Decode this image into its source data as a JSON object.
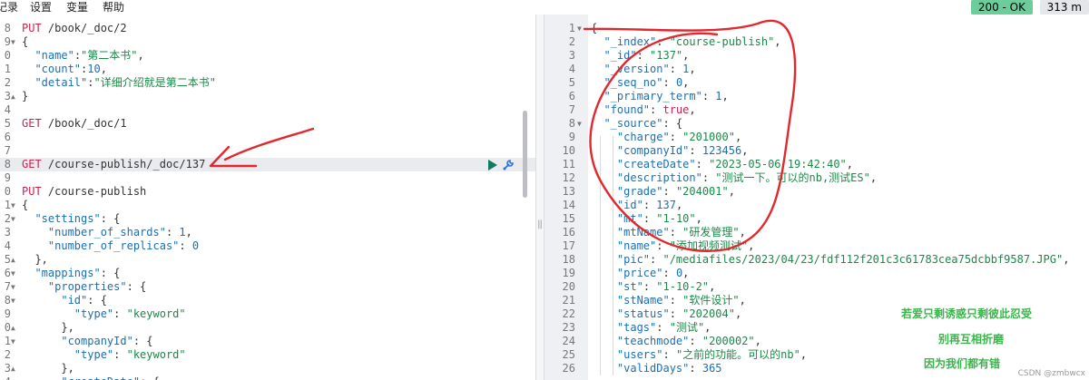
{
  "menu": [
    "记录",
    "设置",
    "变量",
    "帮助"
  ],
  "status": {
    "code": "200 - OK",
    "time": "313 m"
  },
  "left_editor": {
    "lines": [
      {
        "n": "8",
        "fold": "",
        "parts": [
          [
            "m",
            "PUT"
          ],
          [
            "p",
            " /book/_doc/2"
          ]
        ]
      },
      {
        "n": "9",
        "fold": "▼",
        "parts": [
          [
            "p",
            "{"
          ]
        ]
      },
      {
        "n": "0",
        "fold": "",
        "parts": [
          [
            "p",
            "  "
          ],
          [
            "k",
            "\"name\""
          ],
          [
            "p",
            ":"
          ],
          [
            "s",
            "\"第二本书\""
          ],
          [
            "p",
            ","
          ]
        ]
      },
      {
        "n": "1",
        "fold": "",
        "parts": [
          [
            "p",
            "  "
          ],
          [
            "k",
            "\"count\""
          ],
          [
            "p",
            ":"
          ],
          [
            "n",
            "10"
          ],
          [
            "p",
            ","
          ]
        ]
      },
      {
        "n": "2",
        "fold": "",
        "parts": [
          [
            "p",
            "  "
          ],
          [
            "k",
            "\"detail\""
          ],
          [
            "p",
            ":"
          ],
          [
            "s",
            "\"详细介绍就是第二本书\""
          ]
        ]
      },
      {
        "n": "3",
        "fold": "▲",
        "parts": [
          [
            "p",
            "}"
          ]
        ]
      },
      {
        "n": "4",
        "fold": "",
        "parts": []
      },
      {
        "n": "5",
        "fold": "",
        "parts": [
          [
            "m",
            "GET"
          ],
          [
            "p",
            " /book/_doc/1"
          ]
        ]
      },
      {
        "n": "6",
        "fold": "",
        "parts": []
      },
      {
        "n": "7",
        "fold": "",
        "parts": []
      },
      {
        "n": "8",
        "fold": "",
        "parts": [
          [
            "m",
            "GET"
          ],
          [
            "p",
            " /course-publish/_doc/137"
          ]
        ],
        "hl": true
      },
      {
        "n": "9",
        "fold": "",
        "parts": []
      },
      {
        "n": "0",
        "fold": "",
        "parts": [
          [
            "m",
            "PUT"
          ],
          [
            "p",
            " /course-publish"
          ]
        ]
      },
      {
        "n": "1",
        "fold": "▼",
        "parts": [
          [
            "p",
            "{"
          ]
        ]
      },
      {
        "n": "2",
        "fold": "▼",
        "parts": [
          [
            "p",
            "  "
          ],
          [
            "k",
            "\"settings\""
          ],
          [
            "p",
            ": {"
          ]
        ]
      },
      {
        "n": "3",
        "fold": "",
        "parts": [
          [
            "p",
            "    "
          ],
          [
            "k",
            "\"number_of_shards\""
          ],
          [
            "p",
            ": "
          ],
          [
            "n",
            "1"
          ],
          [
            "p",
            ","
          ]
        ]
      },
      {
        "n": "4",
        "fold": "",
        "parts": [
          [
            "p",
            "    "
          ],
          [
            "k",
            "\"number_of_replicas\""
          ],
          [
            "p",
            ": "
          ],
          [
            "n",
            "0"
          ]
        ]
      },
      {
        "n": "5",
        "fold": "▲",
        "parts": [
          [
            "p",
            "  },"
          ]
        ]
      },
      {
        "n": "6",
        "fold": "▼",
        "parts": [
          [
            "p",
            "  "
          ],
          [
            "k",
            "\"mappings\""
          ],
          [
            "p",
            ": {"
          ]
        ]
      },
      {
        "n": "7",
        "fold": "▼",
        "parts": [
          [
            "p",
            "    "
          ],
          [
            "k",
            "\"properties\""
          ],
          [
            "p",
            ": {"
          ]
        ]
      },
      {
        "n": "8",
        "fold": "▼",
        "parts": [
          [
            "p",
            "      "
          ],
          [
            "k",
            "\"id\""
          ],
          [
            "p",
            ": {"
          ]
        ]
      },
      {
        "n": "9",
        "fold": "",
        "parts": [
          [
            "p",
            "        "
          ],
          [
            "k",
            "\"type\""
          ],
          [
            "p",
            ": "
          ],
          [
            "s",
            "\"keyword\""
          ]
        ]
      },
      {
        "n": "0",
        "fold": "▲",
        "parts": [
          [
            "p",
            "      },"
          ]
        ]
      },
      {
        "n": "1",
        "fold": "▼",
        "parts": [
          [
            "p",
            "      "
          ],
          [
            "k",
            "\"companyId\""
          ],
          [
            "p",
            ": {"
          ]
        ]
      },
      {
        "n": "2",
        "fold": "",
        "parts": [
          [
            "p",
            "        "
          ],
          [
            "k",
            "\"type\""
          ],
          [
            "p",
            ": "
          ],
          [
            "s",
            "\"keyword\""
          ]
        ]
      },
      {
        "n": "3",
        "fold": "▲",
        "parts": [
          [
            "p",
            "      },"
          ]
        ]
      },
      {
        "n": "4",
        "fold": "",
        "parts": [
          [
            "p",
            "      "
          ],
          [
            "k",
            "\"createDate\""
          ],
          [
            "p",
            ": {"
          ]
        ]
      }
    ]
  },
  "right_editor": {
    "lines": [
      {
        "n": "1",
        "fold": "▼",
        "parts": [
          [
            "p",
            "{"
          ]
        ]
      },
      {
        "n": "2",
        "fold": "",
        "parts": [
          [
            "p",
            "  "
          ],
          [
            "k",
            "\"_index\""
          ],
          [
            "p",
            ": "
          ],
          [
            "s",
            "\"course-publish\""
          ],
          [
            "p",
            ","
          ]
        ]
      },
      {
        "n": "3",
        "fold": "",
        "parts": [
          [
            "p",
            "  "
          ],
          [
            "k",
            "\"_id\""
          ],
          [
            "p",
            ": "
          ],
          [
            "s",
            "\"137\""
          ],
          [
            "p",
            ","
          ]
        ]
      },
      {
        "n": "4",
        "fold": "",
        "parts": [
          [
            "p",
            "  "
          ],
          [
            "k",
            "\"_version\""
          ],
          [
            "p",
            ": "
          ],
          [
            "n",
            "1"
          ],
          [
            "p",
            ","
          ]
        ]
      },
      {
        "n": "5",
        "fold": "",
        "parts": [
          [
            "p",
            "  "
          ],
          [
            "k",
            "\"_seq_no\""
          ],
          [
            "p",
            ": "
          ],
          [
            "n",
            "0"
          ],
          [
            "p",
            ","
          ]
        ]
      },
      {
        "n": "6",
        "fold": "",
        "parts": [
          [
            "p",
            "  "
          ],
          [
            "k",
            "\"_primary_term\""
          ],
          [
            "p",
            ": "
          ],
          [
            "n",
            "1"
          ],
          [
            "p",
            ","
          ]
        ]
      },
      {
        "n": "7",
        "fold": "",
        "parts": [
          [
            "p",
            "  "
          ],
          [
            "k",
            "\"found\""
          ],
          [
            "p",
            ": "
          ],
          [
            "b",
            "true"
          ],
          [
            "p",
            ","
          ]
        ]
      },
      {
        "n": "8",
        "fold": "▼",
        "parts": [
          [
            "p",
            "  "
          ],
          [
            "k",
            "\"_source\""
          ],
          [
            "p",
            ": {"
          ]
        ]
      },
      {
        "n": "9",
        "fold": "",
        "parts": [
          [
            "p",
            "    "
          ],
          [
            "k",
            "\"charge\""
          ],
          [
            "p",
            ": "
          ],
          [
            "s",
            "\"201000\""
          ],
          [
            "p",
            ","
          ]
        ]
      },
      {
        "n": "10",
        "fold": "",
        "parts": [
          [
            "p",
            "    "
          ],
          [
            "k",
            "\"companyId\""
          ],
          [
            "p",
            ": "
          ],
          [
            "n",
            "123456"
          ],
          [
            "p",
            ","
          ]
        ]
      },
      {
        "n": "11",
        "fold": "",
        "parts": [
          [
            "p",
            "    "
          ],
          [
            "k",
            "\"createDate\""
          ],
          [
            "p",
            ": "
          ],
          [
            "s",
            "\"2023-05-06 19:42:40\""
          ],
          [
            "p",
            ","
          ]
        ]
      },
      {
        "n": "12",
        "fold": "",
        "parts": [
          [
            "p",
            "    "
          ],
          [
            "k",
            "\"description\""
          ],
          [
            "p",
            ": "
          ],
          [
            "s",
            "\"测试一下。可以的nb,测试ES\""
          ],
          [
            "p",
            ","
          ]
        ]
      },
      {
        "n": "13",
        "fold": "",
        "parts": [
          [
            "p",
            "    "
          ],
          [
            "k",
            "\"grade\""
          ],
          [
            "p",
            ": "
          ],
          [
            "s",
            "\"204001\""
          ],
          [
            "p",
            ","
          ]
        ]
      },
      {
        "n": "14",
        "fold": "",
        "parts": [
          [
            "p",
            "    "
          ],
          [
            "k",
            "\"id\""
          ],
          [
            "p",
            ": "
          ],
          [
            "n",
            "137"
          ],
          [
            "p",
            ","
          ]
        ]
      },
      {
        "n": "15",
        "fold": "",
        "parts": [
          [
            "p",
            "    "
          ],
          [
            "k",
            "\"mt\""
          ],
          [
            "p",
            ": "
          ],
          [
            "s",
            "\"1-10\""
          ],
          [
            "p",
            ","
          ]
        ]
      },
      {
        "n": "16",
        "fold": "",
        "parts": [
          [
            "p",
            "    "
          ],
          [
            "k",
            "\"mtName\""
          ],
          [
            "p",
            ": "
          ],
          [
            "s",
            "\"研发管理\""
          ],
          [
            "p",
            ","
          ]
        ]
      },
      {
        "n": "17",
        "fold": "",
        "parts": [
          [
            "p",
            "    "
          ],
          [
            "k",
            "\"name\""
          ],
          [
            "p",
            ": "
          ],
          [
            "s",
            "\"添加视频测试\""
          ],
          [
            "p",
            ","
          ]
        ]
      },
      {
        "n": "18",
        "fold": "",
        "parts": [
          [
            "p",
            "    "
          ],
          [
            "k",
            "\"pic\""
          ],
          [
            "p",
            ": "
          ],
          [
            "s",
            "\"/mediafiles/2023/04/23/fdf112f201c3c61783cea75dcbbf9587.JPG\""
          ],
          [
            "p",
            ","
          ]
        ]
      },
      {
        "n": "19",
        "fold": "",
        "parts": [
          [
            "p",
            "    "
          ],
          [
            "k",
            "\"price\""
          ],
          [
            "p",
            ": "
          ],
          [
            "n",
            "0"
          ],
          [
            "p",
            ","
          ]
        ]
      },
      {
        "n": "20",
        "fold": "",
        "parts": [
          [
            "p",
            "    "
          ],
          [
            "k",
            "\"st\""
          ],
          [
            "p",
            ": "
          ],
          [
            "s",
            "\"1-10-2\""
          ],
          [
            "p",
            ","
          ]
        ]
      },
      {
        "n": "21",
        "fold": "",
        "parts": [
          [
            "p",
            "    "
          ],
          [
            "k",
            "\"stName\""
          ],
          [
            "p",
            ": "
          ],
          [
            "s",
            "\"软件设计\""
          ],
          [
            "p",
            ","
          ]
        ]
      },
      {
        "n": "22",
        "fold": "",
        "parts": [
          [
            "p",
            "    "
          ],
          [
            "k",
            "\"status\""
          ],
          [
            "p",
            ": "
          ],
          [
            "s",
            "\"202004\""
          ],
          [
            "p",
            ","
          ]
        ]
      },
      {
        "n": "23",
        "fold": "",
        "parts": [
          [
            "p",
            "    "
          ],
          [
            "k",
            "\"tags\""
          ],
          [
            "p",
            ": "
          ],
          [
            "s",
            "\"测试\""
          ],
          [
            "p",
            ","
          ]
        ]
      },
      {
        "n": "24",
        "fold": "",
        "parts": [
          [
            "p",
            "    "
          ],
          [
            "k",
            "\"teachmode\""
          ],
          [
            "p",
            ": "
          ],
          [
            "s",
            "\"200002\""
          ],
          [
            "p",
            ","
          ]
        ]
      },
      {
        "n": "25",
        "fold": "",
        "parts": [
          [
            "p",
            "    "
          ],
          [
            "k",
            "\"users\""
          ],
          [
            "p",
            ": "
          ],
          [
            "s",
            "\"之前的功能。可以的nb\""
          ],
          [
            "p",
            ","
          ]
        ]
      },
      {
        "n": "26",
        "fold": "",
        "parts": [
          [
            "p",
            "    "
          ],
          [
            "k",
            "\"validDays\""
          ],
          [
            "p",
            ": "
          ],
          [
            "n",
            "365"
          ]
        ]
      }
    ]
  },
  "overlay_text": [
    "若爱只剩诱惑只剩彼此忍受",
    "别再互相折磨",
    "因为我们都有错"
  ],
  "watermark": "CSDN @zmbwcx",
  "colors": {
    "ok_badge": "#6dcc9b",
    "annotation": "#e0282e",
    "overlay_text": "#39b54a"
  }
}
